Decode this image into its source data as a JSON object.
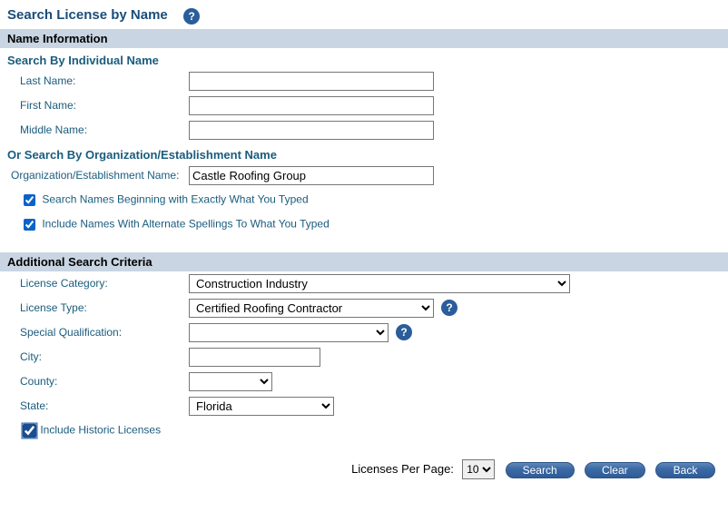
{
  "page": {
    "title": "Search License by Name"
  },
  "sections": {
    "name_info": "Name Information",
    "addl_criteria": "Additional Search Criteria"
  },
  "subheadings": {
    "individual": "Search By Individual Name",
    "organization": "Or Search By Organization/Establishment Name"
  },
  "labels": {
    "last_name": "Last Name:",
    "first_name": "First Name:",
    "middle_name": "Middle Name:",
    "org_name": "Organization/Establishment Name:",
    "license_category": "License Category:",
    "license_type": "License Type:",
    "special_qualification": "Special Qualification:",
    "city": "City:",
    "county": "County:",
    "state": "State:",
    "licenses_per_page": "Licenses Per Page:"
  },
  "values": {
    "last_name": "",
    "first_name": "",
    "middle_name": "",
    "org_name": "Castle Roofing Group",
    "license_category": "Construction Industry",
    "license_type": "Certified Roofing Contractor",
    "special_qualification": "",
    "city": "",
    "county": "",
    "state": "Florida",
    "licenses_per_page": "10"
  },
  "checkboxes": {
    "exact": {
      "label": "Search Names Beginning with Exactly What You Typed",
      "checked": true
    },
    "alt_spellings": {
      "label": "Include Names With Alternate Spellings To What You Typed",
      "checked": true
    },
    "historic": {
      "label": "Include Historic Licenses",
      "checked": true
    }
  },
  "buttons": {
    "search": "Search",
    "clear": "Clear",
    "back": "Back"
  },
  "help_glyph": "?"
}
